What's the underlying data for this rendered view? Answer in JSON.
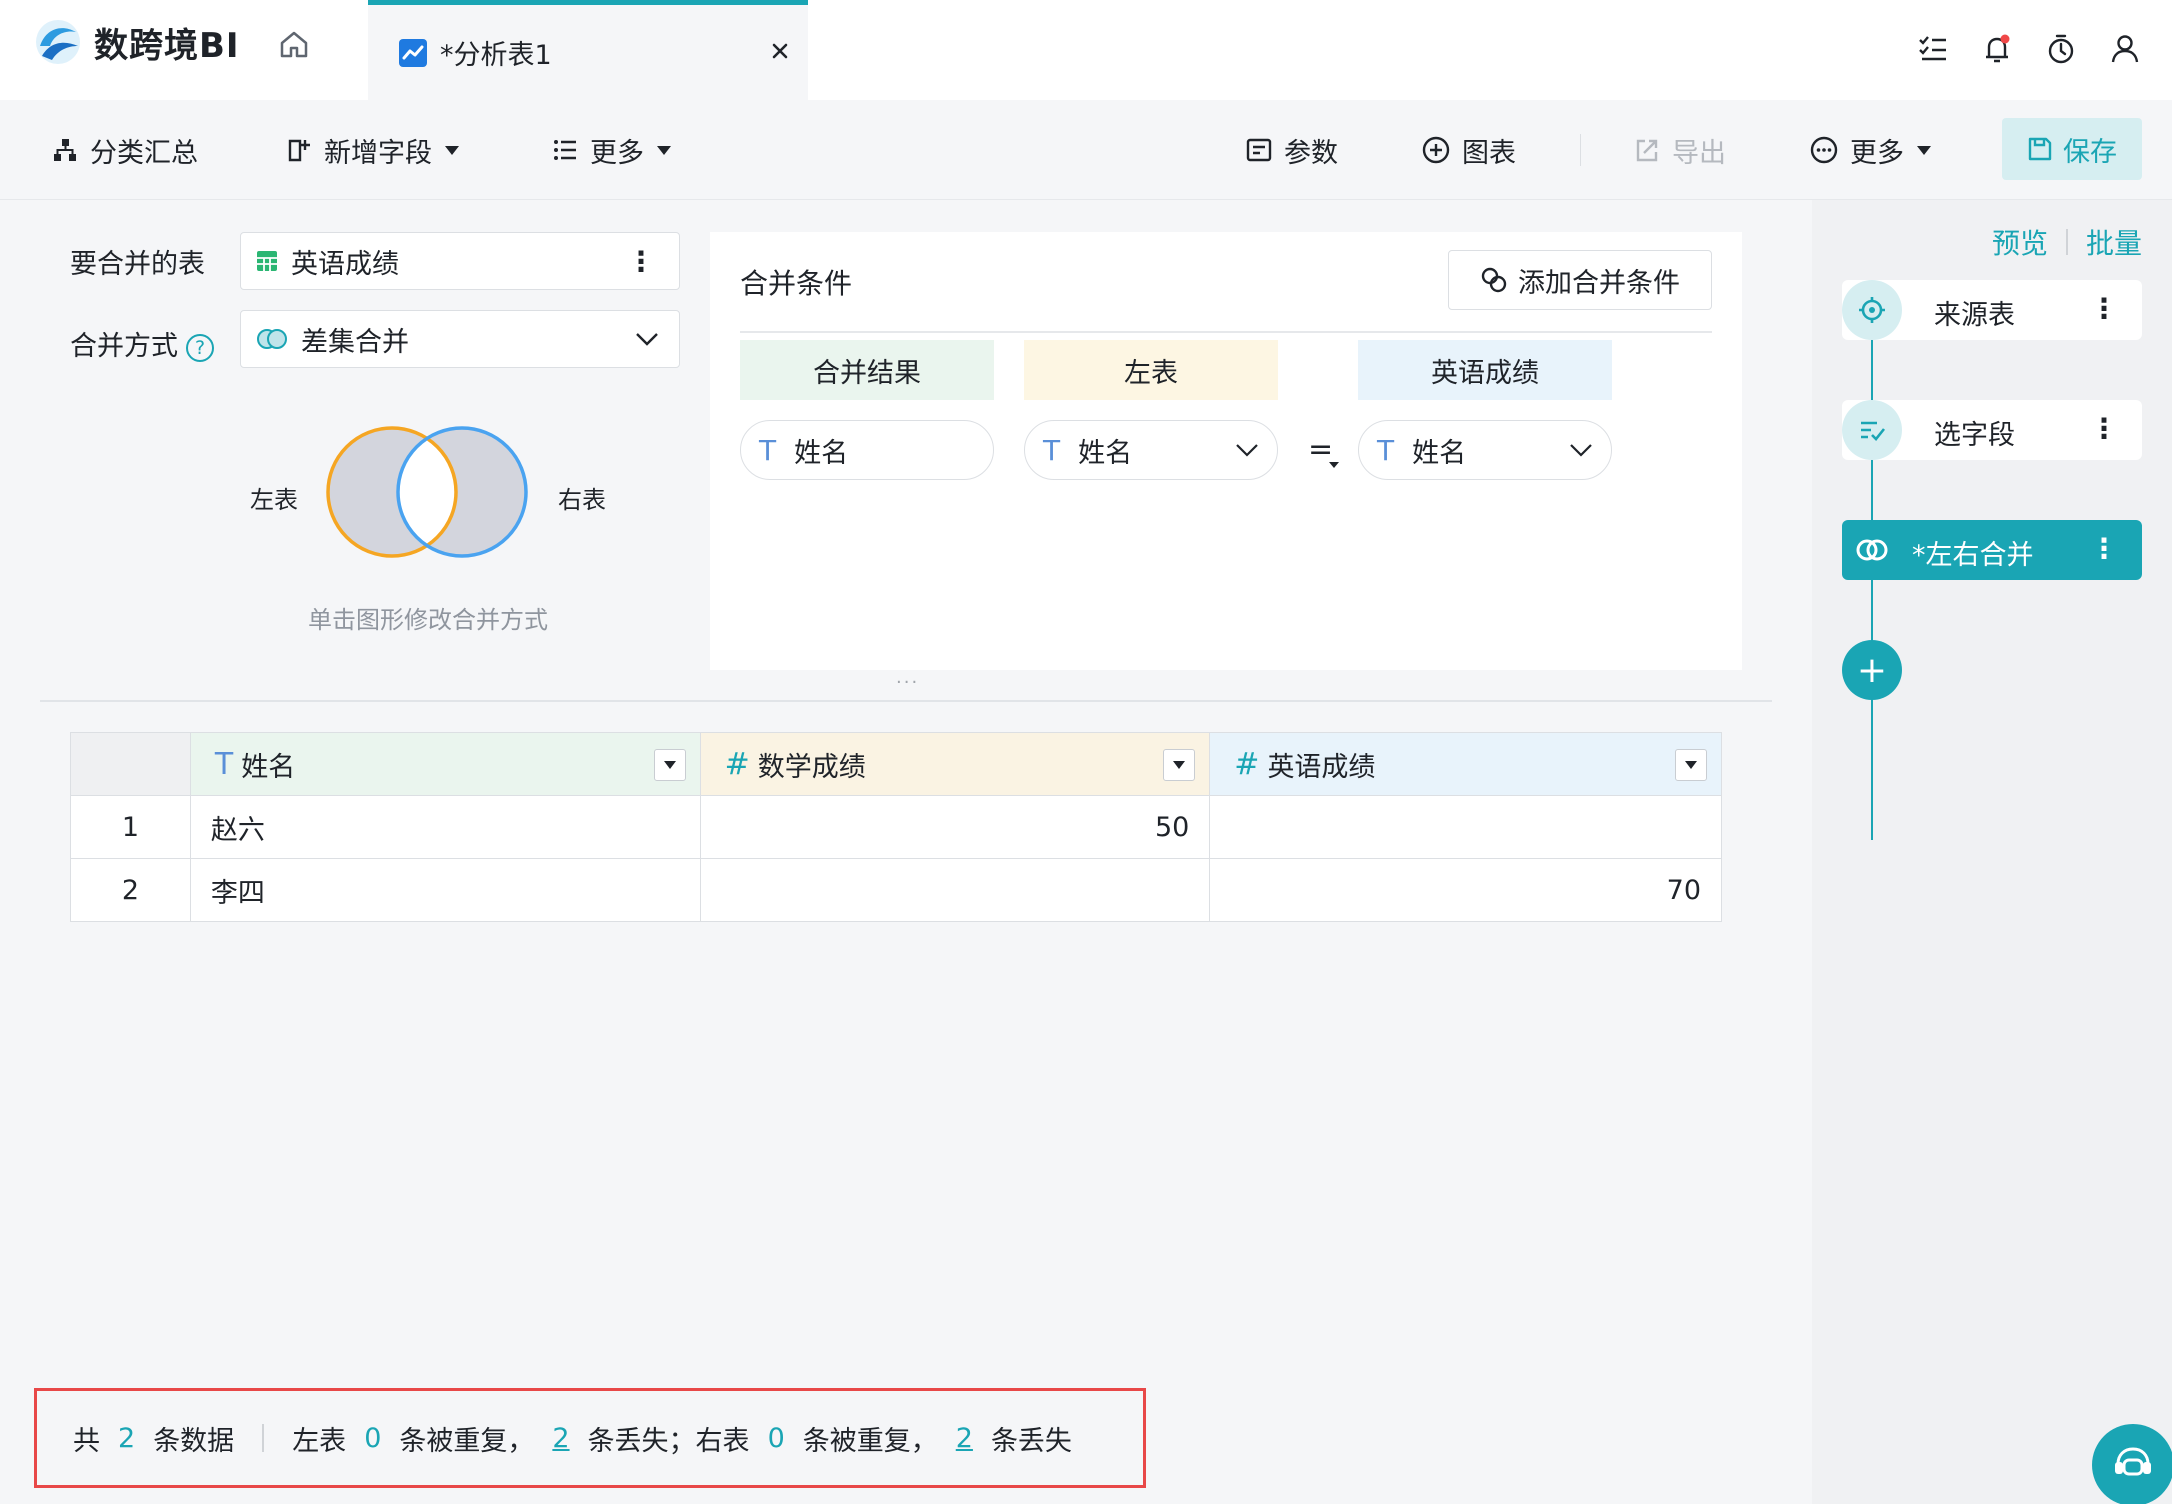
{
  "app": {
    "name": "数跨境BI"
  },
  "tab": {
    "title": "*分析表1"
  },
  "toolbar": {
    "group_summary": "分类汇总",
    "add_field": "新增字段",
    "more_left": "更多",
    "params": "参数",
    "chart": "图表",
    "export": "导出",
    "more_right": "更多",
    "save": "保存"
  },
  "merge": {
    "table_label": "要合并的表",
    "table_value": "英语成绩",
    "mode_label": "合并方式",
    "mode_value": "差集合并",
    "venn_left": "左表",
    "venn_right": "右表",
    "venn_hint": "单击图形修改合并方式"
  },
  "conditions": {
    "title": "合并条件",
    "add_button": "添加合并条件",
    "headers": [
      "合并结果",
      "左表",
      "英语成绩"
    ],
    "result_field": "姓名",
    "left_field": "姓名",
    "right_field": "姓名",
    "operator": "="
  },
  "table": {
    "columns": [
      {
        "type": "T",
        "name": "姓名",
        "color": "#eaf5ee"
      },
      {
        "type": "#",
        "name": "数学成绩",
        "color": "#faf3e3"
      },
      {
        "type": "#",
        "name": "英语成绩",
        "color": "#e8f3fb"
      }
    ],
    "rows": [
      {
        "idx": "1",
        "name": "赵六",
        "math": "50",
        "english": ""
      },
      {
        "idx": "2",
        "name": "李四",
        "math": "",
        "english": "70"
      }
    ]
  },
  "side": {
    "preview": "预览",
    "batch": "批量",
    "steps": [
      {
        "label": "来源表",
        "icon": "source-icon"
      },
      {
        "label": "选字段",
        "icon": "select-fields-icon"
      },
      {
        "label": "*左右合并",
        "icon": "merge-icon"
      }
    ]
  },
  "status": {
    "total_prefix": "共",
    "total": "2",
    "total_suffix": "条数据",
    "left_prefix": "左表",
    "left_dup": "0",
    "dup_text": "条被重复，",
    "left_lost": "2",
    "left_lost_text": "条丢失；右表",
    "right_dup": "0",
    "right_dup_text": "条被重复，",
    "right_lost": "2",
    "lost_text": "条丢失"
  },
  "colors": {
    "accent": "#1aa5b4",
    "venn_left": "#f5a623",
    "venn_right": "#4aa3f0",
    "highlight": "#e84848"
  }
}
